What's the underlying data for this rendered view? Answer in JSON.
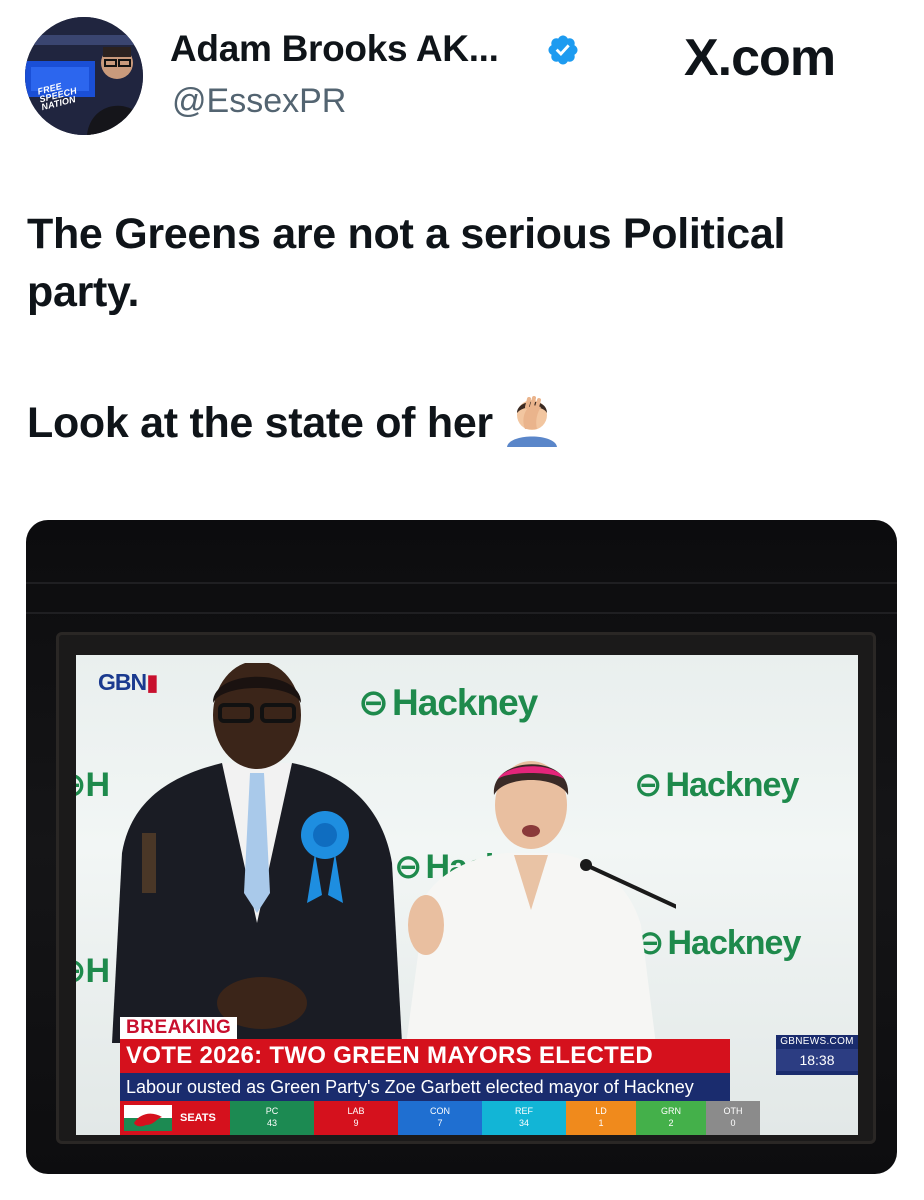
{
  "header": {
    "display_name": "Adam Brooks AK...",
    "handle": "@EssexPR",
    "site_label": "X.com",
    "avatar_text": [
      "FREE",
      "SPEECH",
      "NATION"
    ]
  },
  "tweet": {
    "line1": "The Greens are not a serious Political party.",
    "line2": "Look at the state of her"
  },
  "media": {
    "broadcaster_logo": "GBN",
    "backdrop_sign": "Hackney",
    "breaking_tag": "BREAKING",
    "headline": "VOTE 2026: TWO GREEN MAYORS ELECTED",
    "subline": "Labour ousted as Green Party's Zoe Garbett elected mayor of Hackney",
    "side_site": "GBNEWS.COM",
    "side_time": "18:38",
    "seats_label": "SEATS",
    "seats": [
      {
        "party": "PC",
        "value": "43",
        "color": "#1c8a52"
      },
      {
        "party": "LAB",
        "value": "9",
        "color": "#d5111d"
      },
      {
        "party": "CON",
        "value": "7",
        "color": "#1f6fd1"
      },
      {
        "party": "REF",
        "value": "34",
        "color": "#12b5d6"
      },
      {
        "party": "LD",
        "value": "1",
        "color": "#f08a1c"
      },
      {
        "party": "GRN",
        "value": "2",
        "color": "#44b04a"
      },
      {
        "party": "OTH",
        "value": "0",
        "color": "#8b8b8b"
      }
    ]
  },
  "colors": {
    "verified": "#1d9bf0",
    "hackney_green": "#1e8a4c",
    "breaking_red": "#d5111d",
    "navy": "#1a2c6e"
  },
  "icons": [
    "verified-badge-icon",
    "facepalm-emoji-icon",
    "wales-flag-icon"
  ]
}
